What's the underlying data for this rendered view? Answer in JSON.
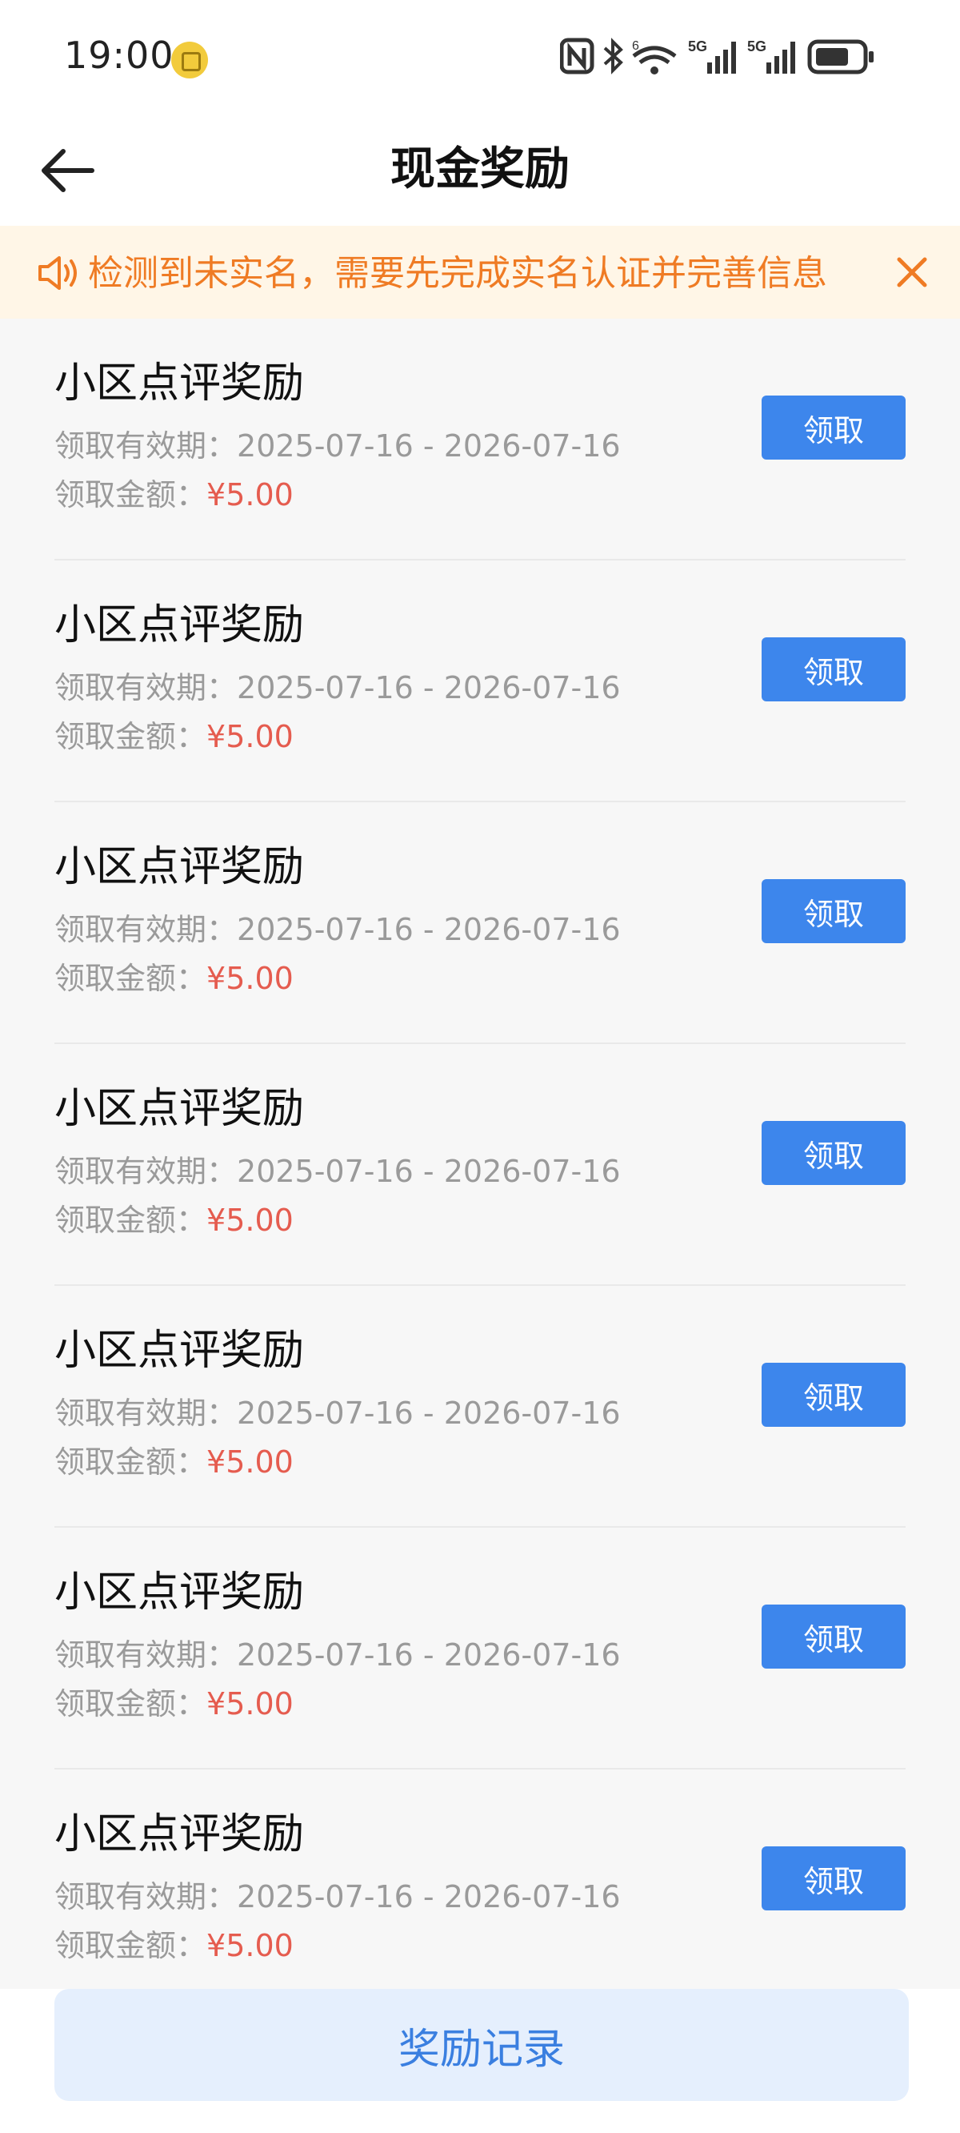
{
  "status_bar": {
    "time": "19:00",
    "network_label_1": "5G",
    "network_label_2": "5G",
    "wifi_badge": "6"
  },
  "header": {
    "title": "现金奖励"
  },
  "notice": {
    "text": "检测到未实名，需要先完成实名认证并完善信息"
  },
  "rewards": [
    {
      "title": "小区点评奖励",
      "period_label": "领取有效期：",
      "period": "2025-07-16 - 2026-07-16",
      "amount_label": "领取金额：",
      "amount": "¥5.00",
      "button": "领取"
    },
    {
      "title": "小区点评奖励",
      "period_label": "领取有效期：",
      "period": "2025-07-16 - 2026-07-16",
      "amount_label": "领取金额：",
      "amount": "¥5.00",
      "button": "领取"
    },
    {
      "title": "小区点评奖励",
      "period_label": "领取有效期：",
      "period": "2025-07-16 - 2026-07-16",
      "amount_label": "领取金额：",
      "amount": "¥5.00",
      "button": "领取"
    },
    {
      "title": "小区点评奖励",
      "period_label": "领取有效期：",
      "period": "2025-07-16 - 2026-07-16",
      "amount_label": "领取金额：",
      "amount": "¥5.00",
      "button": "领取"
    },
    {
      "title": "小区点评奖励",
      "period_label": "领取有效期：",
      "period": "2025-07-16 - 2026-07-16",
      "amount_label": "领取金额：",
      "amount": "¥5.00",
      "button": "领取"
    },
    {
      "title": "小区点评奖励",
      "period_label": "领取有效期：",
      "period": "2025-07-16 - 2026-07-16",
      "amount_label": "领取金额：",
      "amount": "¥5.00",
      "button": "领取"
    },
    {
      "title": "小区点评奖励",
      "period_label": "领取有效期：",
      "period": "2025-07-16 - 2026-07-16",
      "amount_label": "领取金额：",
      "amount": "¥5.00",
      "button": "领取"
    }
  ],
  "footer": {
    "record_button": "奖励记录"
  },
  "colors": {
    "accent": "#3d86ec",
    "notice_text": "#ef7b24",
    "amount": "#e55c4f"
  }
}
